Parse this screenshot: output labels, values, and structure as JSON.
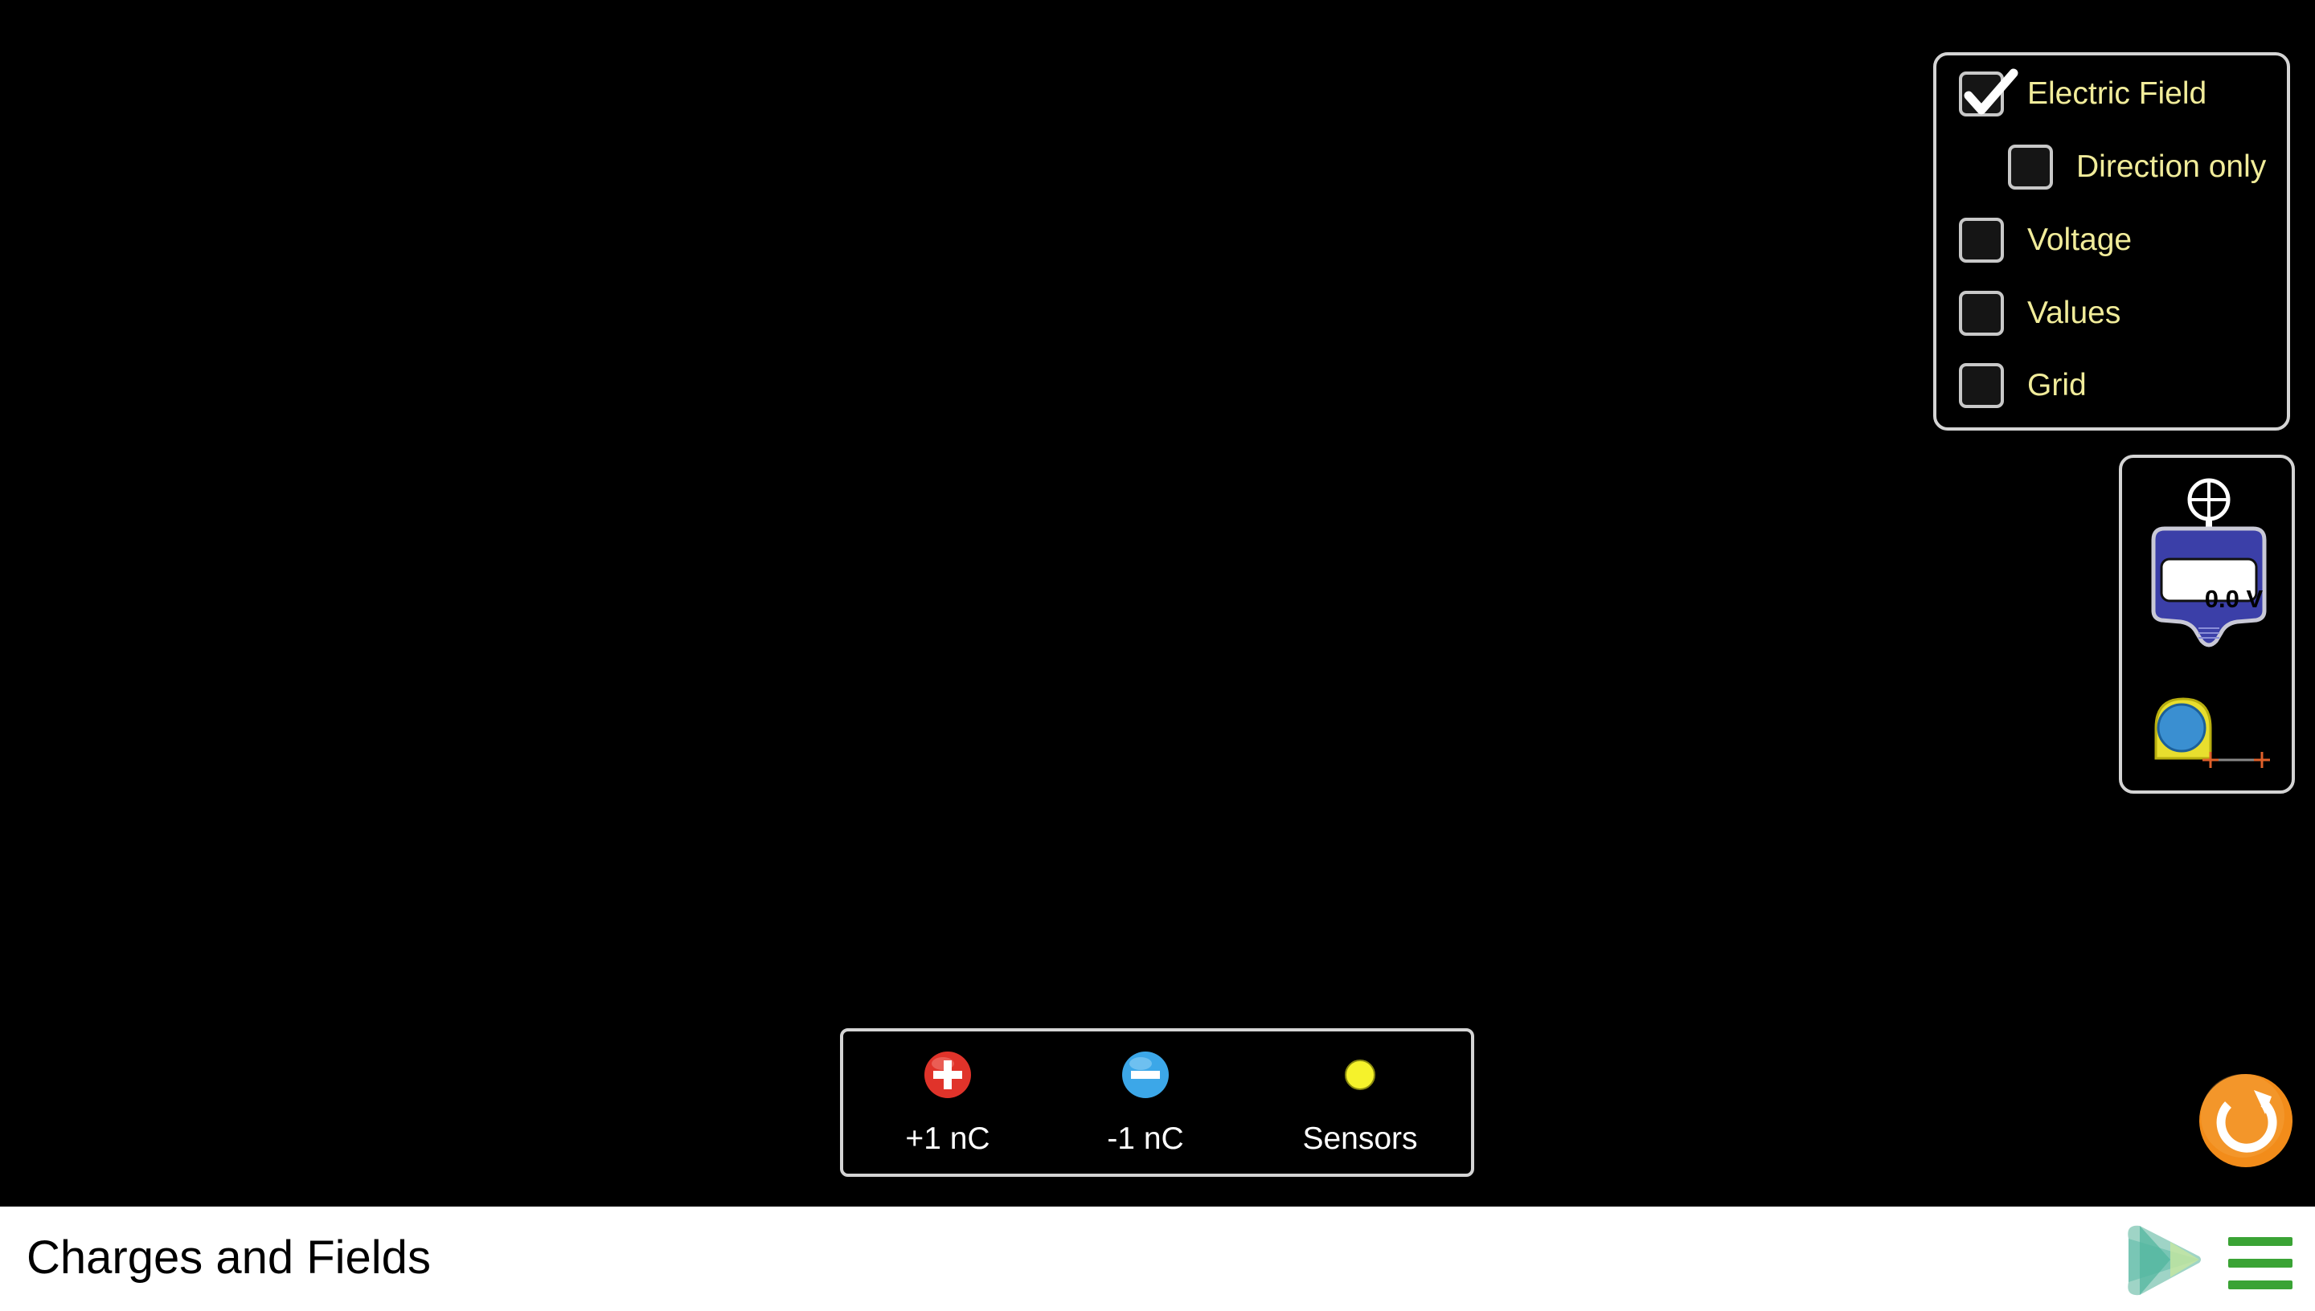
{
  "app": {
    "title": "Charges and Fields"
  },
  "control_panel": {
    "items": [
      {
        "label": "Electric Field",
        "checked": true,
        "indent": false
      },
      {
        "label": "Direction only",
        "checked": false,
        "indent": true
      },
      {
        "label": "Voltage",
        "checked": false,
        "indent": false
      },
      {
        "label": "Values",
        "checked": false,
        "indent": false
      },
      {
        "label": "Grid",
        "checked": false,
        "indent": false
      }
    ]
  },
  "toolbox": {
    "voltmeter_reading": "0.0 V",
    "voltmeter_icon": "voltmeter-icon",
    "tape_icon": "measuring-tape-icon"
  },
  "charges_panel": {
    "positive_label": "+1 nC",
    "negative_label": "-1 nC",
    "sensors_label": "Sensors",
    "positive_color": "#e0332a",
    "negative_color": "#3ca7e8",
    "sensor_color": "#f5f22b"
  },
  "colors": {
    "background": "#000000",
    "label_yellow": "#f1ec9a",
    "panel_border": "#d4d4d4",
    "reset_orange": "#f28c1a",
    "menu_green": "#3aa335"
  }
}
